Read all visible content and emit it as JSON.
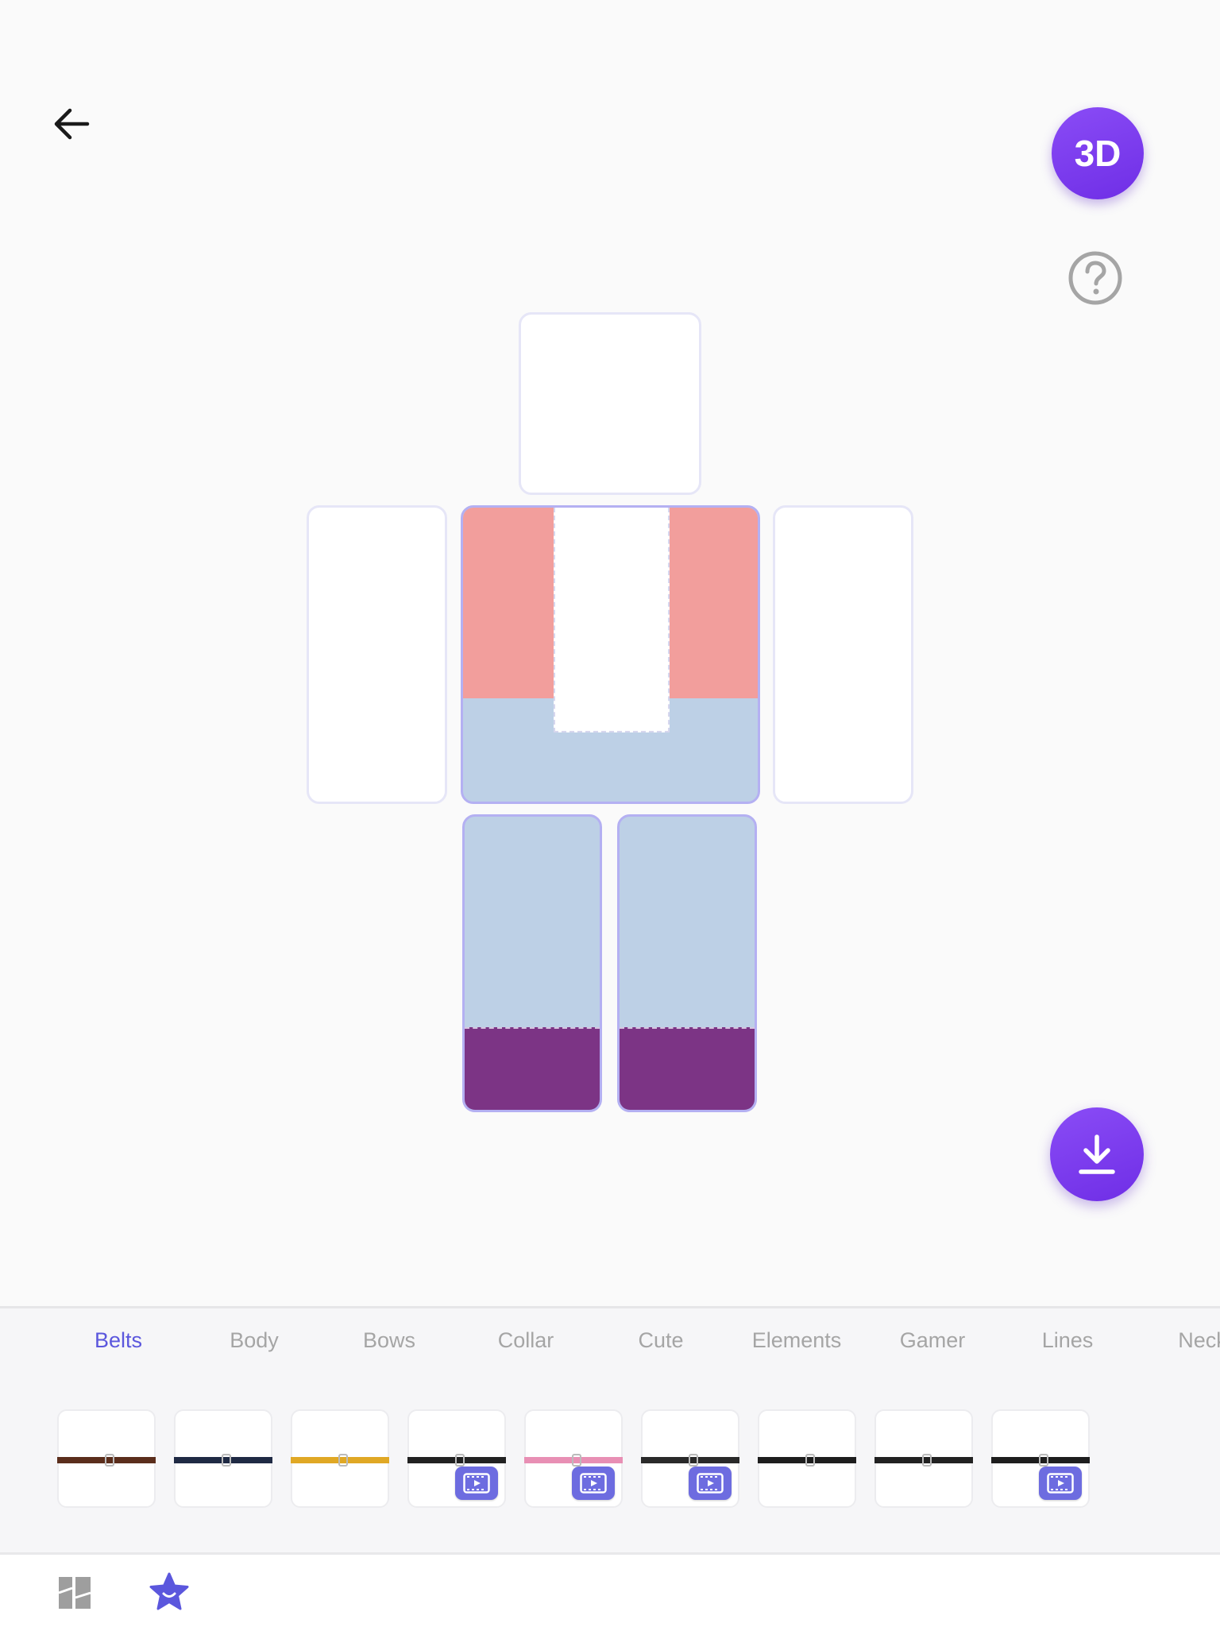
{
  "header": {
    "back_icon": "arrow-left-icon",
    "view_3d_label": "3D",
    "help_icon": "question-circle-icon"
  },
  "canvas": {
    "colors": {
      "shirt_pink": "#f29e9c",
      "pants_blue": "#bdd0e6",
      "shoes_purple": "#7c3485",
      "accent": "#7b3cf0"
    }
  },
  "actions": {
    "download_icon": "download-icon"
  },
  "categories": {
    "tabs": [
      {
        "label": "Belts",
        "active": true
      },
      {
        "label": "Body",
        "active": false
      },
      {
        "label": "Bows",
        "active": false
      },
      {
        "label": "Collar",
        "active": false
      },
      {
        "label": "Cute",
        "active": false
      },
      {
        "label": "Elements",
        "active": false
      },
      {
        "label": "Gamer",
        "active": false
      },
      {
        "label": "Lines",
        "active": false
      },
      {
        "label": "Neck",
        "active": false
      }
    ]
  },
  "items": [
    {
      "name": "brown-belt",
      "color": "#5b2e1c",
      "video": false
    },
    {
      "name": "navy-belt",
      "color": "#1f2a44",
      "video": false
    },
    {
      "name": "yellow-belt",
      "color": "#e0a825",
      "video": false
    },
    {
      "name": "black-skull-belt",
      "color": "#222222",
      "video": true
    },
    {
      "name": "pink-heart-belt",
      "color": "#e88fb4",
      "video": true
    },
    {
      "name": "black-simple-belt",
      "color": "#2a2a2a",
      "video": true
    },
    {
      "name": "black-double-buckle-belt",
      "color": "#1e1e1e",
      "video": false
    },
    {
      "name": "black-heart-belt",
      "color": "#222222",
      "video": false
    },
    {
      "name": "black-bow-belt",
      "color": "#1e1e1e",
      "video": true
    }
  ],
  "bottom_nav": [
    {
      "icon": "templates-icon",
      "active": false
    },
    {
      "icon": "star-face-icon",
      "active": true
    }
  ]
}
